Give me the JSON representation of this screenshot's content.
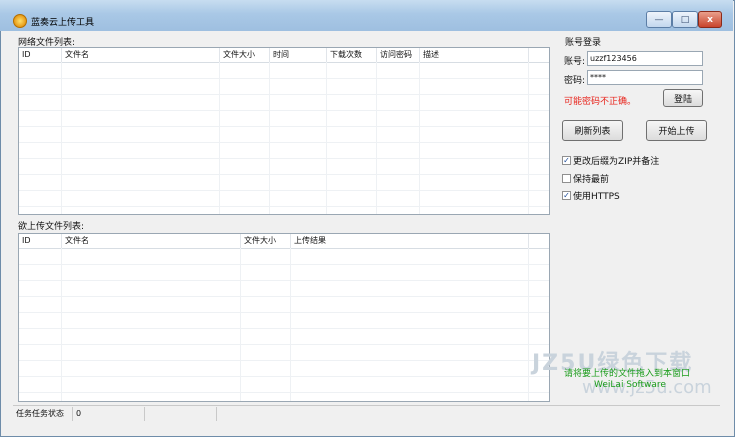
{
  "window": {
    "title": "蓝奏云上传工具",
    "minimize_glyph": "—",
    "maximize_glyph": "□",
    "close_glyph": "x"
  },
  "network_files": {
    "label": "网络文件列表:",
    "columns": [
      "ID",
      "文件名",
      "文件大小",
      "时间",
      "下载次数",
      "访问密码",
      "描述"
    ]
  },
  "upload_files": {
    "label": "欲上传文件列表:",
    "columns": [
      "ID",
      "文件名",
      "文件大小",
      "上传结果"
    ]
  },
  "login": {
    "section_title": "账号登录",
    "account_label": "账号:",
    "account_value": "uzzf123456",
    "password_label": "密码:",
    "password_value": "****",
    "error_message": "可能密码不正确。",
    "login_button": "登陆",
    "error_color": "#e8231b"
  },
  "actions": {
    "refresh_button": "刷新列表",
    "upload_button": "开始上传"
  },
  "options": [
    {
      "label": "更改后缀为ZIP并备注",
      "checked": true
    },
    {
      "label": "保持最前",
      "checked": false
    },
    {
      "label": "使用HTTPS",
      "checked": true
    }
  ],
  "drop_hint": "请将要上传的文件拖入到本窗口",
  "brand": "WeiLai Software",
  "watermark": {
    "text": "JZ5U绿色下载",
    "url": "www.jz5u.com"
  },
  "status": {
    "label": "任务任务状态",
    "value": "0"
  },
  "icons": {
    "title": "app-logo-icon",
    "check": "✓"
  }
}
